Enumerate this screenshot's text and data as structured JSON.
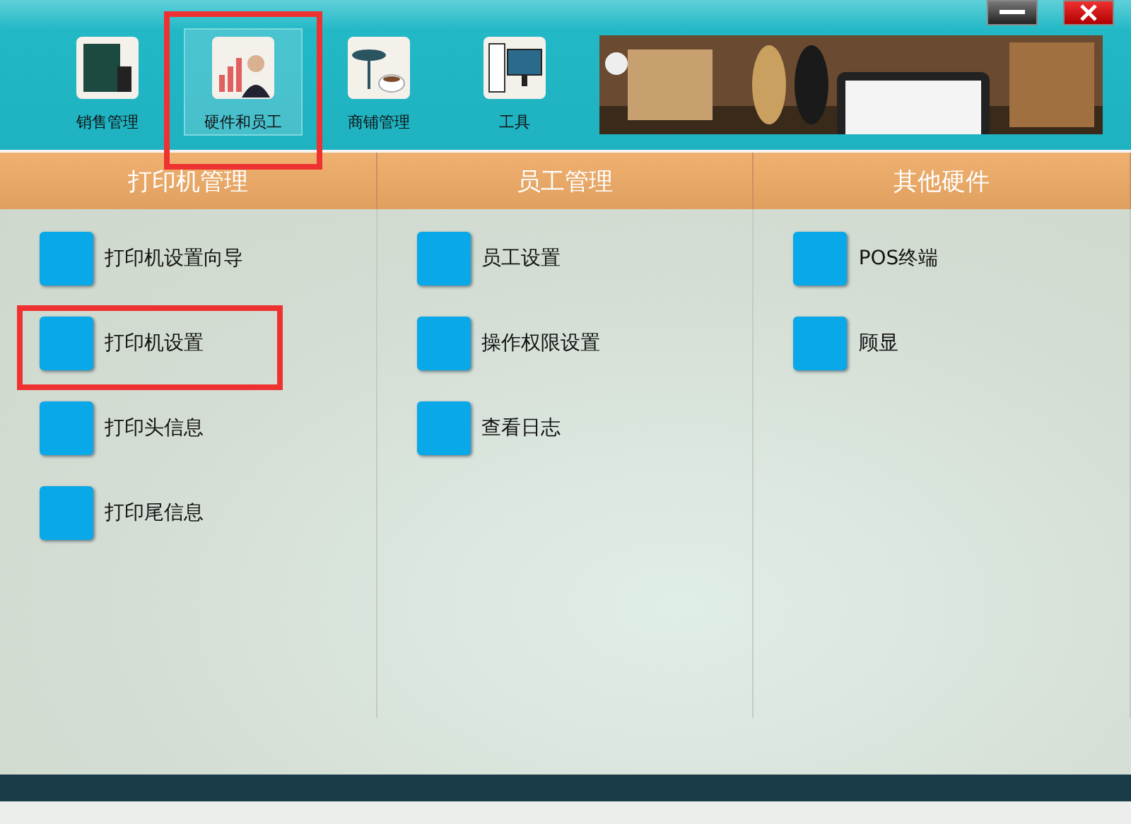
{
  "window_controls": [
    {
      "kind": "minimize"
    },
    {
      "kind": "close"
    }
  ],
  "nav": [
    {
      "label": "销售管理",
      "selected": false,
      "highlighted": false
    },
    {
      "label": "硬件和员工",
      "selected": true,
      "highlighted": true
    },
    {
      "label": "商铺管理",
      "selected": false,
      "highlighted": false
    },
    {
      "label": "工具",
      "selected": false,
      "highlighted": false
    }
  ],
  "columns": [
    {
      "title": "打印机管理",
      "items": [
        {
          "label": "打印机设置向导",
          "highlighted": false
        },
        {
          "label": "打印机设置",
          "highlighted": true
        },
        {
          "label": "打印头信息",
          "highlighted": false
        },
        {
          "label": "打印尾信息",
          "highlighted": false
        }
      ]
    },
    {
      "title": "员工管理",
      "items": [
        {
          "label": "员工设置",
          "highlighted": false
        },
        {
          "label": "操作权限设置",
          "highlighted": false
        },
        {
          "label": "查看日志",
          "highlighted": false
        }
      ]
    },
    {
      "title": "其他硬件",
      "items": [
        {
          "label": "POS终端",
          "highlighted": false
        },
        {
          "label": "顾显",
          "highlighted": false
        }
      ]
    }
  ]
}
